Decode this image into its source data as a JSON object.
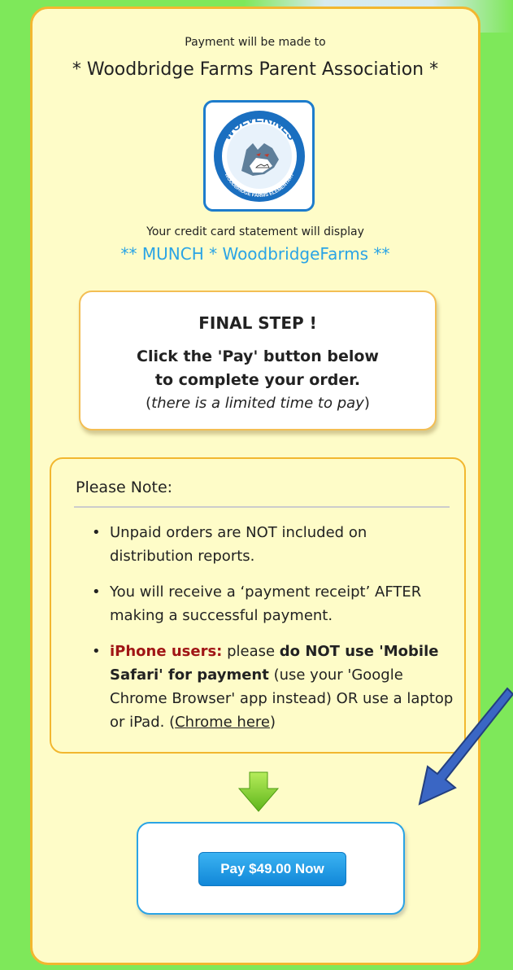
{
  "payment": {
    "payto_label": "Payment will be made to",
    "payto_name": "* Woodbridge Farms Parent Association *",
    "logo_text_top": "WOLVERINES",
    "logo_text_bottom": "WOODBRIDGE FARMS ELEMENTARY",
    "statement_label": "Your credit card statement will display",
    "statement_name": "** MUNCH * WoodbridgeFarms **"
  },
  "final_step": {
    "title": "FINAL STEP !",
    "line1": "Click the 'Pay' button below",
    "line2": "to complete your order.",
    "note_open": "(",
    "note_italic": "there is a limited time to pay",
    "note_close": ")"
  },
  "note": {
    "title": "Please Note:",
    "item1": "Unpaid orders are NOT included on distribution reports.",
    "item2": "You will receive a ‘payment receipt’ AFTER making a successful payment.",
    "item3_red": "iPhone users:",
    "item3_a": " please ",
    "item3_bold": "do NOT use 'Mobile Safari' for payment",
    "item3_b": " (use your 'Google Chrome Browser' app instead) OR use a laptop or iPad. (",
    "item3_link": "Chrome here",
    "item3_c": ")",
    "bullet": "•"
  },
  "pay": {
    "button_label": "Pay $49.00 Now"
  },
  "colors": {
    "page_bg": "#7ee85a",
    "card_bg": "#fefcc8",
    "accent_border": "#f2b72f",
    "statement_blue": "#2aa4e5",
    "alert_red": "#a01515",
    "button_blue": "#1187d8",
    "arrow_green": "#6cc21f",
    "pointer_blue": "#3a66c4"
  }
}
